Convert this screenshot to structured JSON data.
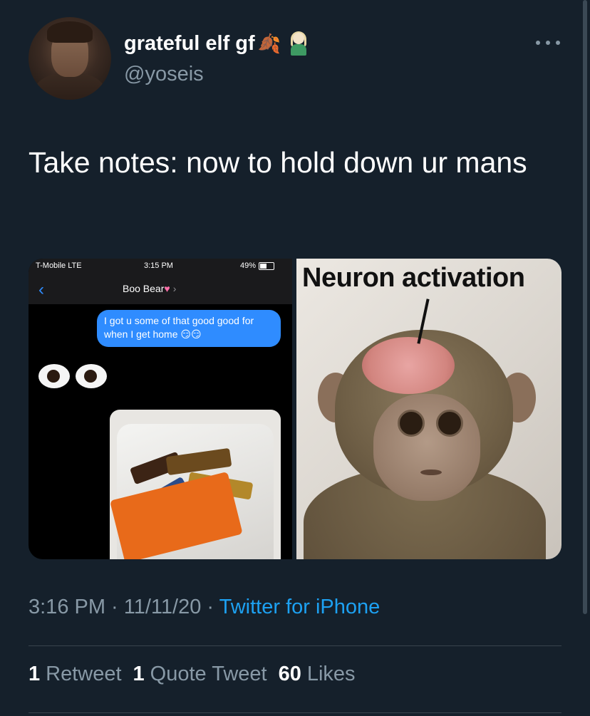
{
  "author": {
    "display_name": "grateful elf gf",
    "handle": "@yoseis",
    "name_emoji": [
      "leaf-icon",
      "elf-icon"
    ]
  },
  "tweet": {
    "text": "Take notes: now to hold down ur mans",
    "timestamp": "3:16 PM · 11/11/20 · ",
    "source": "Twitter for iPhone"
  },
  "media": {
    "left": {
      "status_carrier": "T-Mobile  LTE",
      "status_time": "3:15 PM",
      "status_battery": "49%",
      "contact_name": "Boo Bear",
      "message": "I got u some of that good good for when I get home 😏😏"
    },
    "right": {
      "caption": "Neuron activation"
    }
  },
  "stats": {
    "retweets_count": "1",
    "retweets_label": "Retweet",
    "quotes_count": "1",
    "quotes_label": "Quote Tweet",
    "likes_count": "60",
    "likes_label": "Likes"
  },
  "colors": {
    "background": "#15202b",
    "link": "#1da1f2",
    "secondary_text": "#8899a6",
    "imessage_blue": "#2f8cff"
  }
}
